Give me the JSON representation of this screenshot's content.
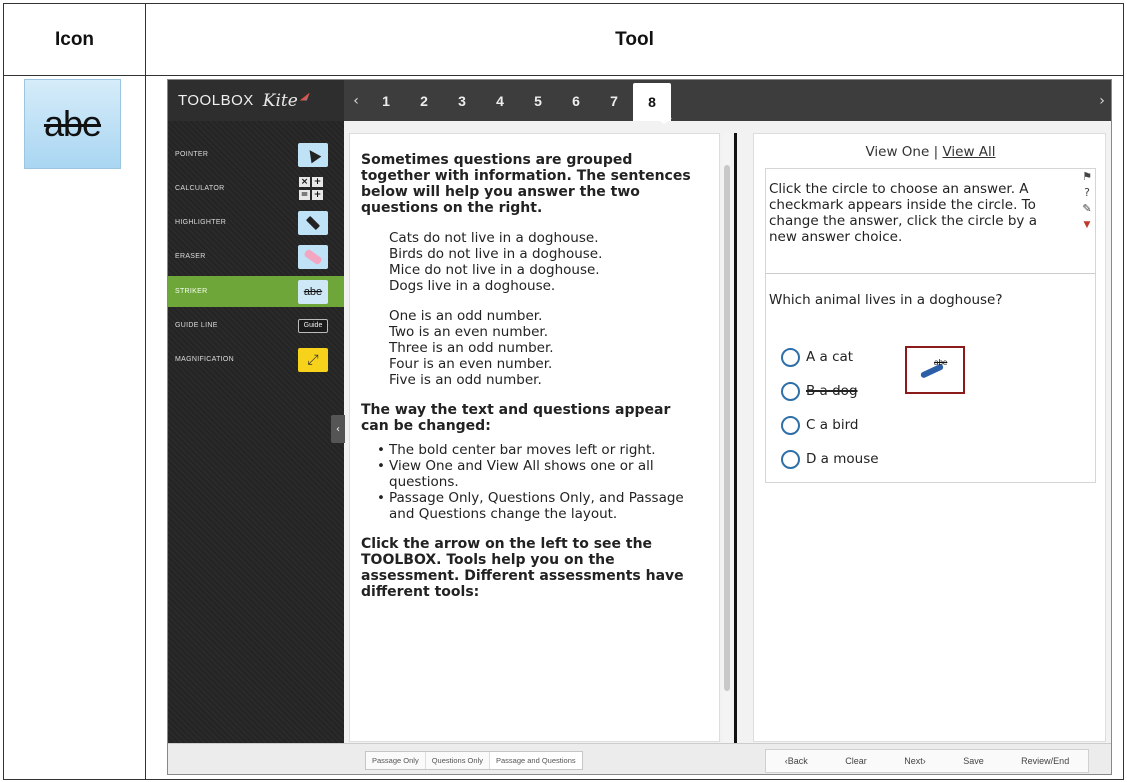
{
  "table": {
    "header_icon": "Icon",
    "header_tool": "Tool",
    "striker_icon_text": "abe"
  },
  "app": {
    "brand_toolbox": "TOOLBOX",
    "brand_kite": "Kite",
    "nav_prev": "‹",
    "nav_next": "›",
    "question_tabs": [
      "1",
      "2",
      "3",
      "4",
      "5",
      "6",
      "7",
      "8"
    ],
    "active_tab": "8"
  },
  "toolbox": {
    "items": [
      {
        "label": "POINTER",
        "icon": "pointer-icon"
      },
      {
        "label": "CALCULATOR",
        "icon": "calculator-icon",
        "keys": [
          "×",
          "+",
          "=",
          "+"
        ]
      },
      {
        "label": "HIGHLIGHTER",
        "icon": "highlighter-icon"
      },
      {
        "label": "ERASER",
        "icon": "eraser-icon"
      },
      {
        "label": "STRIKER",
        "icon": "striker-icon",
        "button_text": "abe",
        "active": true
      },
      {
        "label": "GUIDE LINE",
        "icon": "guide-line-icon",
        "button_text": "Guide"
      },
      {
        "label": "MAGNIFICATION",
        "icon": "magnification-icon",
        "button_text": "⤢"
      }
    ],
    "collapse_arrow": "‹",
    "active_color": "#6fa63a"
  },
  "passage": {
    "intro": "Sometimes questions are grouped together with information. The sentences below will help you answer the two questions on the right.",
    "block1": [
      "Cats do not live in a doghouse.",
      "Birds do not live in a doghouse.",
      "Mice do not live in a doghouse.",
      "Dogs live in a doghouse."
    ],
    "block2": [
      "One is an odd number.",
      "Two is an even number.",
      "Three is an odd number.",
      "Four is an even number.",
      "Five is an odd number."
    ],
    "layout_heading": "The way the text and questions appear can be changed:",
    "bullets": [
      "The bold center bar moves left or right.",
      "View One and View All shows one or all questions.",
      "Passage Only, Questions Only, and Passage and Questions change the layout."
    ],
    "toolbox_heading": "Click the arrow on the left to see the TOOLBOX. Tools help you on the assessment. Different assessments have different tools:"
  },
  "questions": {
    "view_one": "View One",
    "separator": "|",
    "view_all": "View All",
    "instructions": "Click the circle to choose an answer. A checkmark appears inside the circle. To change the answer, click the circle by a new answer choice.",
    "side_icons": {
      "flag": "⚑",
      "help": "?",
      "notes": "✎",
      "caret": "▼"
    },
    "stem": "Which animal lives in a doghouse?",
    "answers": [
      {
        "text": "A  a cat",
        "struck": false
      },
      {
        "text": "B  a dog",
        "struck": true
      },
      {
        "text": "C  a bird",
        "struck": false
      },
      {
        "text": "D  a mouse",
        "struck": false
      }
    ],
    "callout_label": "abe"
  },
  "bottom": {
    "layout_buttons": [
      "Passage Only",
      "Questions Only",
      "Passage and Questions"
    ],
    "active_layout": "Passage and Questions",
    "nav_buttons": [
      "‹Back",
      "Clear",
      "Next›",
      "Save",
      "Review/End"
    ]
  },
  "colors": {
    "accent_green": "#6fa63a",
    "radio_blue": "#2f6fa8",
    "callout_border": "#8b1a1a",
    "striker_icon_bg": "#bfe2f6"
  }
}
